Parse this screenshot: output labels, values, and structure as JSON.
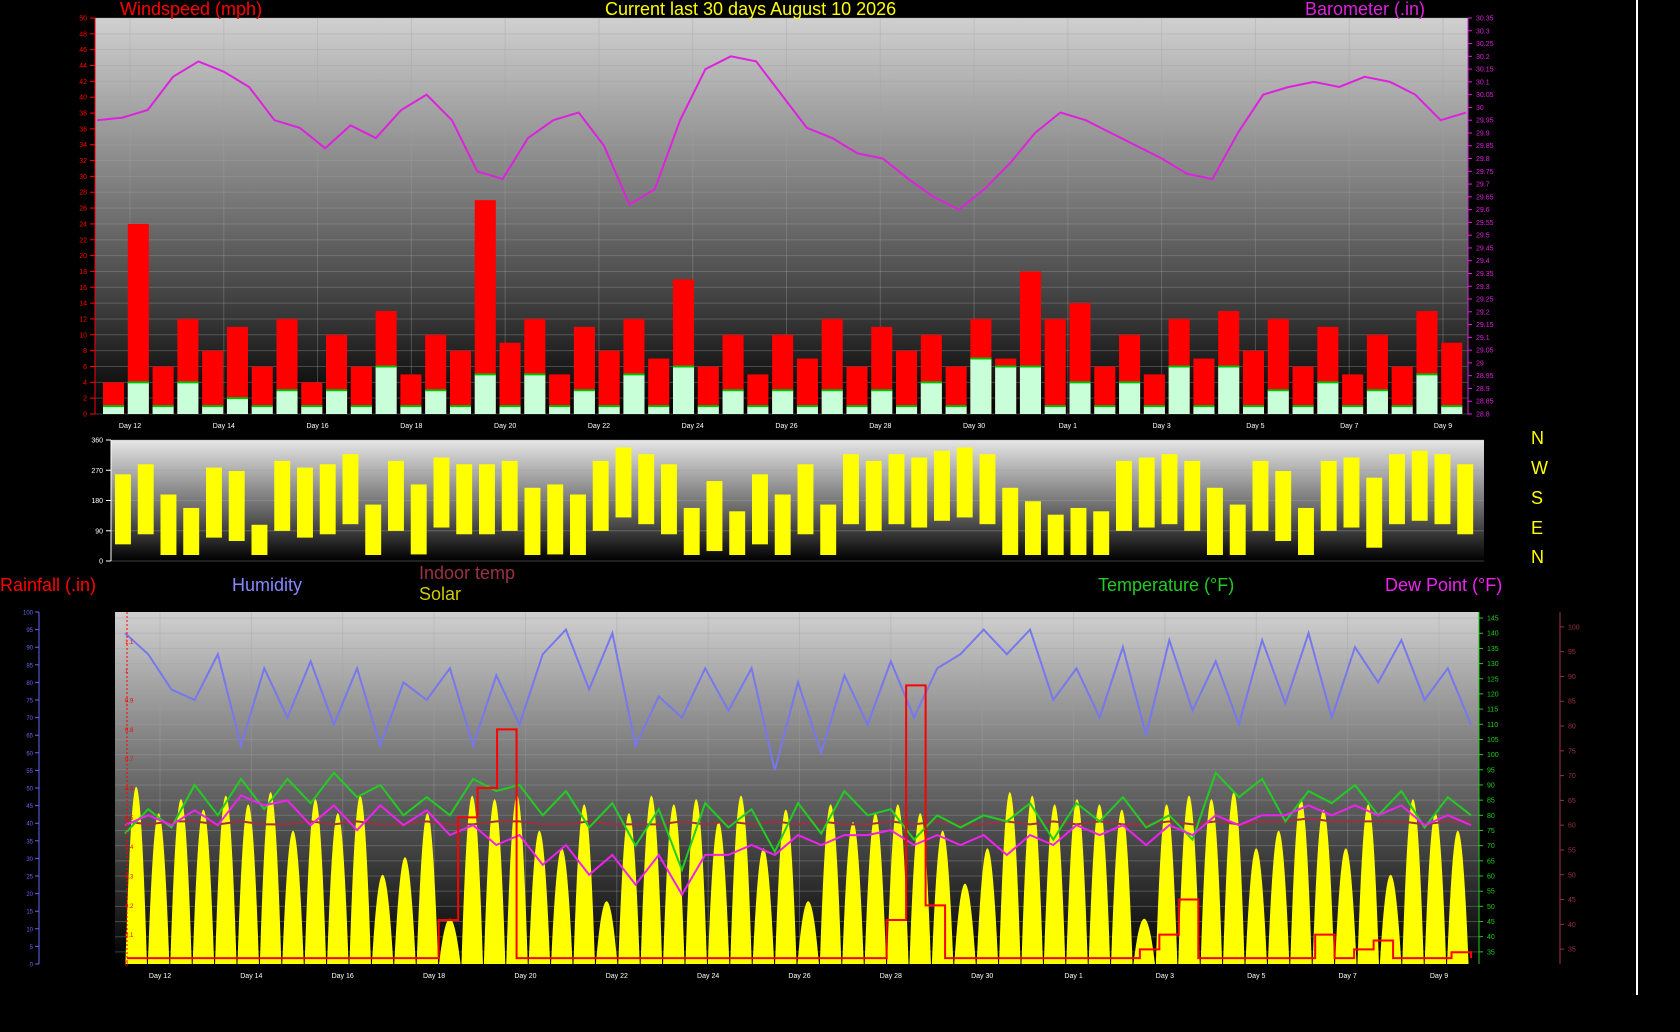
{
  "titles": {
    "main": "Current last 30 days August 10 2026",
    "windspeed": "Windspeed (mph)",
    "barometer": "Barometer (.in)",
    "rainfall": "Rainfall (.in)",
    "humidity": "Humidity",
    "indoor_temp": "Indoor temp",
    "solar": "Solar",
    "temperature": "Temperature (°F)",
    "dew_point": "Dew Point (°F)"
  },
  "direction_letters": [
    "N",
    "W",
    "S",
    "E",
    "N"
  ],
  "colors": {
    "windspeed": "#ff0000",
    "gust": "#ff0000",
    "avg_wind": "#00c000",
    "barometer": "#dd22dd",
    "direction": "#ffff00",
    "rainfall": "#ff0000",
    "humidity": "#7777ee",
    "indoor_temp": "#993344",
    "solar": "#ffff00",
    "temperature": "#22cc22",
    "dew_point": "#ee22ee"
  },
  "chart_data": [
    {
      "type": "line",
      "name": "wind-barometer",
      "x_ticks": [
        "Day 12",
        "Day 14",
        "Day 16",
        "Day 18",
        "Day 20",
        "Day 22",
        "Day 24",
        "Day 26",
        "Day 28",
        "Day 30",
        "Day 1",
        "Day 3",
        "Day 5",
        "Day 7",
        "Day 9"
      ],
      "y_left": {
        "ticks": [
          0,
          2,
          4,
          6,
          8,
          10,
          12,
          14,
          16,
          18,
          20,
          22,
          24,
          26,
          28,
          30,
          32,
          34,
          36,
          38,
          40,
          42,
          44,
          46,
          48,
          50
        ],
        "range": [
          0,
          50
        ]
      },
      "y_right": {
        "ticks": [
          28.8,
          28.85,
          28.9,
          28.95,
          29,
          29.05,
          29.1,
          29.15,
          29.2,
          29.25,
          29.3,
          29.35,
          29.4,
          29.45,
          29.5,
          29.55,
          29.6,
          29.65,
          29.7,
          29.75,
          29.8,
          29.85,
          29.9,
          29.95,
          30,
          30.05,
          30.1,
          30.15,
          30.2,
          30.25,
          30.3,
          30.35
        ],
        "range": [
          28.8,
          30.35
        ]
      },
      "series": [
        {
          "name": "Barometer (.in)",
          "axis": "right",
          "values": [
            29.95,
            29.96,
            29.99,
            30.12,
            30.18,
            30.14,
            30.08,
            29.95,
            29.92,
            29.84,
            29.93,
            29.88,
            29.99,
            30.05,
            29.95,
            29.75,
            29.72,
            29.88,
            29.95,
            29.98,
            29.85,
            29.62,
            29.68,
            29.95,
            30.15,
            30.2,
            30.18,
            30.05,
            29.92,
            29.88,
            29.82,
            29.8,
            29.72,
            29.65,
            29.6,
            29.68,
            29.78,
            29.9,
            29.98,
            29.95,
            29.9,
            29.85,
            29.8,
            29.74,
            29.72,
            29.9,
            30.05,
            30.08,
            30.1,
            30.08,
            30.12,
            30.1,
            30.05,
            29.95,
            29.98
          ]
        },
        {
          "name": "Wind gust (mph)",
          "axis": "left",
          "values": [
            4,
            24,
            6,
            12,
            8,
            11,
            6,
            12,
            4,
            10,
            6,
            13,
            5,
            10,
            8,
            27,
            9,
            12,
            5,
            11,
            8,
            12,
            7,
            17,
            6,
            10,
            5,
            10,
            7,
            12,
            6,
            11,
            8,
            10,
            6,
            12,
            7,
            18,
            12,
            14,
            6,
            10,
            5,
            12,
            7,
            13,
            8,
            12,
            6,
            11,
            5,
            10,
            6,
            13,
            9
          ]
        },
        {
          "name": "Average wind (mph)",
          "axis": "left",
          "values": [
            1,
            4,
            1,
            4,
            1,
            2,
            1,
            3,
            1,
            3,
            1,
            6,
            1,
            3,
            1,
            5,
            1,
            5,
            1,
            3,
            1,
            5,
            1,
            6,
            1,
            3,
            1,
            3,
            1,
            3,
            1,
            3,
            1,
            4,
            1,
            7,
            6,
            6,
            1,
            4,
            1,
            4,
            1,
            6,
            1,
            6,
            1,
            3,
            1,
            4,
            1,
            3,
            1,
            5,
            1
          ]
        }
      ]
    },
    {
      "type": "line",
      "name": "wind-direction",
      "y_ticks": [
        0,
        90,
        180,
        270,
        360
      ],
      "range": [
        0,
        360
      ],
      "x_ticks": [],
      "series": [
        {
          "name": "Direction",
          "values": [
            240,
            270,
            180,
            140,
            260,
            250,
            90,
            280,
            260,
            270,
            300,
            150,
            280,
            210,
            290,
            270,
            270,
            280,
            200,
            210,
            180,
            280,
            320,
            300,
            270,
            140,
            220,
            130,
            240,
            180,
            270,
            150,
            300,
            280,
            300,
            290,
            310,
            320,
            300,
            200,
            160,
            120,
            140,
            130,
            280,
            290,
            300,
            280,
            200,
            150,
            280,
            250,
            140,
            280,
            290,
            230,
            300,
            310,
            300,
            270
          ]
        }
      ]
    },
    {
      "type": "line",
      "name": "temperature-humidity-solar",
      "x_ticks": [
        "Day 12",
        "Day 14",
        "Day 16",
        "Day 18",
        "Day 20",
        "Day 22",
        "Day 24",
        "Day 26",
        "Day 28",
        "Day 30",
        "Day 1",
        "Day 3",
        "Day 5",
        "Day 7",
        "Day 9"
      ],
      "y_temp": {
        "ticks": [
          35,
          40,
          45,
          50,
          55,
          60,
          65,
          70,
          75,
          80,
          85,
          90,
          95,
          100,
          105,
          110,
          115,
          120,
          125,
          130,
          135,
          140,
          145
        ],
        "range": [
          31,
          147
        ]
      },
      "y_dew": {
        "ticks": [
          35,
          40,
          45,
          50,
          55,
          60,
          65,
          70,
          75,
          80,
          85,
          90,
          95,
          100
        ],
        "range": [
          32,
          103
        ]
      },
      "y_rain": {
        "ticks": [
          0,
          0.1,
          0.2,
          0.3,
          0.4,
          0.5,
          0.6,
          0.7,
          0.8,
          0.9,
          1,
          1.1
        ],
        "range": [
          0,
          1.2
        ]
      },
      "y_left_ticks": [
        0,
        5,
        10,
        15,
        20,
        25,
        30,
        35,
        40,
        45,
        50,
        55,
        60,
        65,
        70,
        75,
        80,
        85,
        90,
        95,
        100
      ],
      "series": [
        {
          "name": "Humidity",
          "values": [
            94,
            88,
            78,
            75,
            88,
            62,
            84,
            70,
            86,
            68,
            84,
            62,
            80,
            75,
            84,
            62,
            82,
            68,
            88,
            95,
            78,
            94,
            62,
            76,
            70,
            84,
            72,
            84,
            55,
            80,
            60,
            82,
            68,
            86,
            70,
            84,
            88,
            95,
            88,
            95,
            75,
            84,
            70,
            90,
            65,
            92,
            72,
            86,
            68,
            92,
            74,
            94,
            70,
            90,
            80,
            92,
            75,
            84,
            68
          ]
        },
        {
          "name": "Indoor temp",
          "values": [
            78,
            77,
            78,
            78,
            77,
            78,
            77,
            77,
            78,
            77,
            78,
            77,
            77,
            78,
            77,
            77,
            78,
            78,
            77,
            77,
            78,
            77,
            77,
            77,
            78,
            77,
            78,
            77,
            78,
            77,
            78,
            77,
            77,
            78,
            77,
            78,
            77,
            77,
            78,
            77,
            78,
            77,
            78,
            77,
            77,
            78,
            77,
            78,
            77,
            78,
            78,
            79,
            78,
            78,
            78,
            78,
            77,
            78,
            78
          ]
        },
        {
          "name": "Temperature (°F)",
          "values": [
            74,
            82,
            76,
            90,
            80,
            92,
            82,
            92,
            84,
            94,
            86,
            90,
            80,
            86,
            80,
            92,
            88,
            90,
            80,
            88,
            76,
            84,
            70,
            82,
            62,
            84,
            76,
            82,
            68,
            84,
            74,
            88,
            80,
            82,
            72,
            80,
            76,
            80,
            78,
            84,
            72,
            84,
            78,
            86,
            76,
            80,
            72,
            94,
            86,
            92,
            78,
            88,
            84,
            90,
            80,
            88,
            76,
            86,
            80
          ]
        },
        {
          "name": "Dew Point (°F)",
          "values": [
            60,
            62,
            60,
            63,
            60,
            66,
            64,
            65,
            60,
            64,
            59,
            64,
            60,
            63,
            58,
            60,
            56,
            58,
            52,
            56,
            50,
            54,
            48,
            54,
            46,
            54,
            54,
            56,
            54,
            58,
            56,
            58,
            58,
            59,
            56,
            58,
            56,
            58,
            54,
            58,
            56,
            60,
            58,
            60,
            56,
            60,
            58,
            62,
            60,
            62,
            62,
            64,
            62,
            64,
            62,
            64,
            60,
            62,
            60
          ]
        },
        {
          "name": "Solar",
          "values": [
            95,
            80,
            88,
            82,
            90,
            85,
            92,
            70,
            88,
            80,
            90,
            45,
            55,
            80,
            20,
            90,
            88,
            90,
            70,
            60,
            85,
            30,
            80,
            90,
            85,
            88,
            75,
            90,
            60,
            82,
            30,
            85,
            75,
            80,
            85,
            80,
            70,
            40,
            60,
            92,
            90,
            85,
            88,
            85,
            82,
            20,
            85,
            90,
            88,
            92,
            60,
            70,
            88,
            82,
            60,
            85,
            45,
            88,
            80,
            70
          ]
        },
        {
          "name": "Rainfall (.in)",
          "values": [
            0.02,
            0.02,
            0.02,
            0.02,
            0.02,
            0.02,
            0.02,
            0.02,
            0.02,
            0.02,
            0.02,
            0.02,
            0.02,
            0.02,
            0.02,
            0.02,
            0.15,
            0.5,
            0.6,
            0.8,
            0.02,
            0.02,
            0.02,
            0.02,
            0.02,
            0.02,
            0.02,
            0.02,
            0.02,
            0.02,
            0.02,
            0.02,
            0.02,
            0.02,
            0.02,
            0.02,
            0.02,
            0.02,
            0.02,
            0.15,
            0.95,
            0.2,
            0.02,
            0.02,
            0.02,
            0.02,
            0.02,
            0.02,
            0.02,
            0.02,
            0.02,
            0.02,
            0.05,
            0.1,
            0.22,
            0.02,
            0.02,
            0.02,
            0.02,
            0.02,
            0.02,
            0.1,
            0.02,
            0.05,
            0.08,
            0.02,
            0.02,
            0.02,
            0.04,
            0.02
          ]
        }
      ]
    }
  ]
}
